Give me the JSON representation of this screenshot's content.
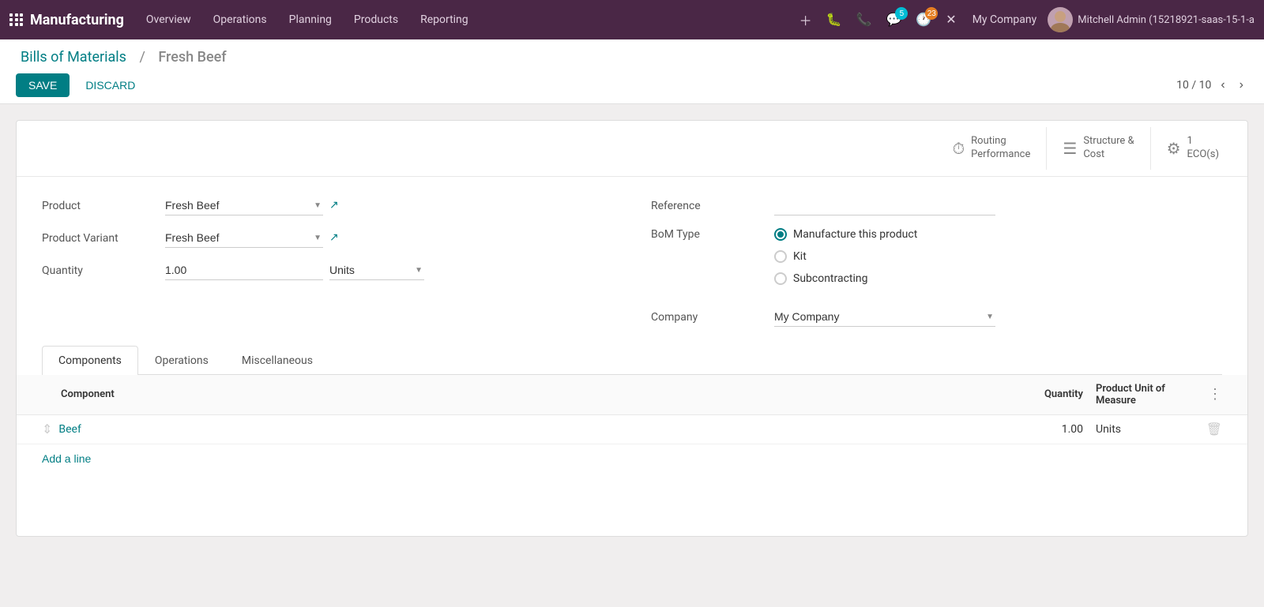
{
  "app": {
    "title": "Manufacturing"
  },
  "nav": {
    "items": [
      {
        "label": "Overview"
      },
      {
        "label": "Operations"
      },
      {
        "label": "Planning"
      },
      {
        "label": "Products"
      },
      {
        "label": "Reporting"
      }
    ]
  },
  "topbar": {
    "company": "My Company",
    "user": "Mitchell Admin (15218921-saas-15-1-a",
    "chat_badge": "5",
    "clock_badge": "23"
  },
  "breadcrumb": {
    "parent": "Bills of Materials",
    "current": "Fresh Beef"
  },
  "toolbar": {
    "save_label": "SAVE",
    "discard_label": "DISCARD",
    "pagination": "10 / 10"
  },
  "smart_buttons": [
    {
      "icon": "⏱",
      "label": "Routing\nPerformance"
    },
    {
      "icon": "≡",
      "label": "Structure &\nCost"
    },
    {
      "icon": "⚙",
      "label": "1\nECO(s)"
    }
  ],
  "form": {
    "product_label": "Product",
    "product_value": "Fresh Beef",
    "product_variant_label": "Product Variant",
    "product_variant_value": "Fresh Beef",
    "quantity_label": "Quantity",
    "quantity_value": "1.00",
    "quantity_unit": "Units",
    "reference_label": "Reference",
    "reference_value": "",
    "bom_type_label": "BoM Type",
    "bom_options": [
      {
        "label": "Manufacture this product",
        "selected": true
      },
      {
        "label": "Kit",
        "selected": false
      },
      {
        "label": "Subcontracting",
        "selected": false
      }
    ],
    "company_label": "Company",
    "company_value": "My Company"
  },
  "tabs": [
    {
      "label": "Components",
      "active": true
    },
    {
      "label": "Operations",
      "active": false
    },
    {
      "label": "Miscellaneous",
      "active": false
    }
  ],
  "table": {
    "col_component": "Component",
    "col_qty": "Quantity",
    "col_uom": "Product Unit of Measure",
    "rows": [
      {
        "component": "Beef",
        "qty": "1.00",
        "uom": "Units"
      }
    ],
    "add_line": "Add a line"
  }
}
